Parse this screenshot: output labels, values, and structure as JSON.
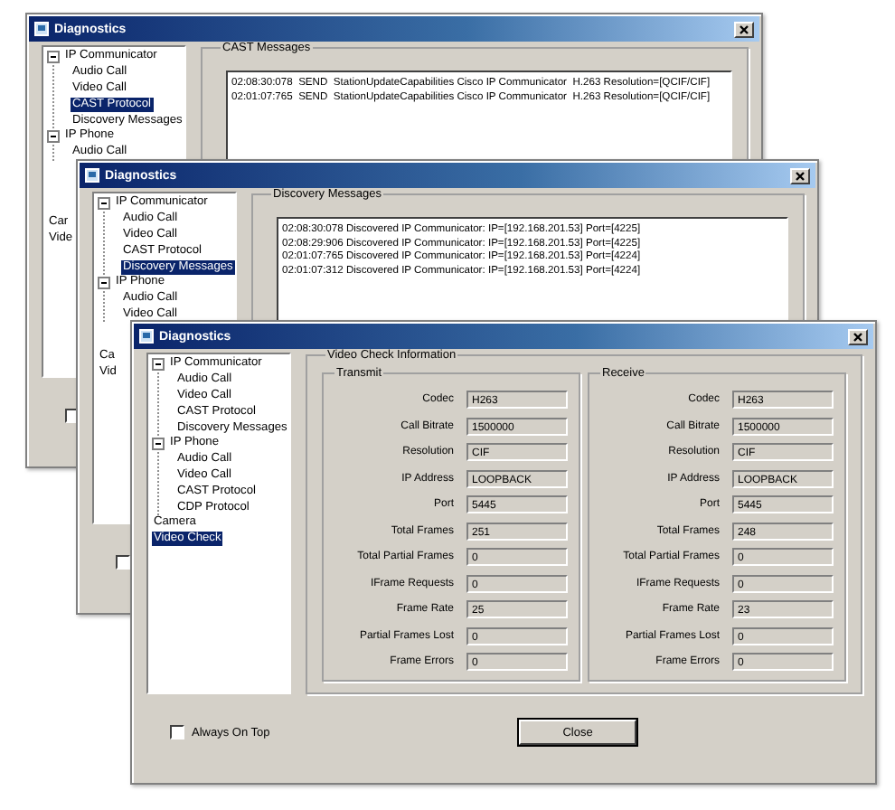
{
  "windows": [
    {
      "title": "Diagnostics",
      "tree": {
        "items": [
          {
            "label": "IP Communicator",
            "selected": false,
            "expanded": true,
            "children": [
              {
                "label": "Audio Call",
                "selected": false
              },
              {
                "label": "Video Call",
                "selected": false
              },
              {
                "label": "CAST Protocol",
                "selected": true
              },
              {
                "label": "Discovery Messages",
                "selected": false
              }
            ]
          },
          {
            "label": "IP Phone",
            "selected": false,
            "expanded": true,
            "children": [
              {
                "label": "Audio Call",
                "selected": false
              }
            ]
          }
        ],
        "trailing_items": [
          {
            "label": "Car",
            "selected": false
          },
          {
            "label": "Vide",
            "selected": false
          }
        ]
      },
      "panel": {
        "kind": "messages",
        "title": "CAST Messages",
        "messages": [
          "02:08:30:078  SEND  StationUpdateCapabilities Cisco IP Communicator  H.263 Resolution=[QCIF/CIF]",
          "02:01:07:765  SEND  StationUpdateCapabilities Cisco IP Communicator  H.263 Resolution=[QCIF/CIF]"
        ]
      },
      "always_on_top": {
        "checked": false
      }
    },
    {
      "title": "Diagnostics",
      "tree": {
        "items": [
          {
            "label": "IP Communicator",
            "selected": false,
            "expanded": true,
            "children": [
              {
                "label": "Audio Call",
                "selected": false
              },
              {
                "label": "Video Call",
                "selected": false
              },
              {
                "label": "CAST Protocol",
                "selected": false
              },
              {
                "label": "Discovery Messages",
                "selected": true
              }
            ]
          },
          {
            "label": "IP Phone",
            "selected": false,
            "expanded": true,
            "children": [
              {
                "label": "Audio Call",
                "selected": false
              },
              {
                "label": "Video Call",
                "selected": false
              }
            ]
          }
        ],
        "trailing_items": [
          {
            "label": "Ca",
            "selected": false
          },
          {
            "label": "Vid",
            "selected": false
          }
        ]
      },
      "panel": {
        "kind": "messages",
        "title": "Discovery Messages",
        "messages": [
          "02:08:30:078 Discovered IP Communicator: IP=[192.168.201.53] Port=[4225]",
          "02:08:29:906 Discovered IP Communicator: IP=[192.168.201.53] Port=[4225]",
          "02:01:07:765 Discovered IP Communicator: IP=[192.168.201.53] Port=[4224]",
          "02:01:07:312 Discovered IP Communicator: IP=[192.168.201.53] Port=[4224]"
        ]
      },
      "always_on_top": {
        "checked": false
      }
    },
    {
      "title": "Diagnostics",
      "tree": {
        "items": [
          {
            "label": "IP Communicator",
            "selected": false,
            "expanded": true,
            "children": [
              {
                "label": "Audio Call",
                "selected": false
              },
              {
                "label": "Video Call",
                "selected": false
              },
              {
                "label": "CAST Protocol",
                "selected": false
              },
              {
                "label": "Discovery Messages",
                "selected": false
              }
            ]
          },
          {
            "label": "IP Phone",
            "selected": false,
            "expanded": true,
            "children": [
              {
                "label": "Audio Call",
                "selected": false
              },
              {
                "label": "Video Call",
                "selected": false
              },
              {
                "label": "CAST Protocol",
                "selected": false
              },
              {
                "label": "CDP Protocol",
                "selected": false
              }
            ]
          },
          {
            "label": "Camera",
            "selected": false
          },
          {
            "label": "Video Check",
            "selected": true
          }
        ]
      },
      "panel": {
        "kind": "video_check",
        "title": "Video Check Information",
        "groups": [
          {
            "title": "Transmit",
            "fields": [
              {
                "label": "Codec",
                "value": "H263"
              },
              {
                "label": "Call Bitrate",
                "value": "1500000"
              },
              {
                "label": "Resolution",
                "value": "CIF"
              },
              {
                "label": "IP Address",
                "value": "LOOPBACK"
              },
              {
                "label": "Port",
                "value": "5445"
              },
              {
                "label": "Total Frames",
                "value": "251"
              },
              {
                "label": "Total Partial Frames",
                "value": "0"
              },
              {
                "label": "IFrame Requests",
                "value": "0"
              },
              {
                "label": "Frame Rate",
                "value": "25"
              },
              {
                "label": "Partial Frames Lost",
                "value": "0"
              },
              {
                "label": "Frame Errors",
                "value": "0"
              }
            ]
          },
          {
            "title": "Receive",
            "fields": [
              {
                "label": "Codec",
                "value": "H263"
              },
              {
                "label": "Call Bitrate",
                "value": "1500000"
              },
              {
                "label": "Resolution",
                "value": "CIF"
              },
              {
                "label": "IP Address",
                "value": "LOOPBACK"
              },
              {
                "label": "Port",
                "value": "5445"
              },
              {
                "label": "Total Frames",
                "value": "248"
              },
              {
                "label": "Total Partial Frames",
                "value": "0"
              },
              {
                "label": "IFrame Requests",
                "value": "0"
              },
              {
                "label": "Frame Rate",
                "value": "23"
              },
              {
                "label": "Partial Frames Lost",
                "value": "0"
              },
              {
                "label": "Frame Errors",
                "value": "0"
              }
            ]
          }
        ]
      },
      "always_on_top": {
        "label": "Always On Top",
        "checked": false
      },
      "buttons": [
        {
          "label": "Close"
        }
      ]
    }
  ]
}
